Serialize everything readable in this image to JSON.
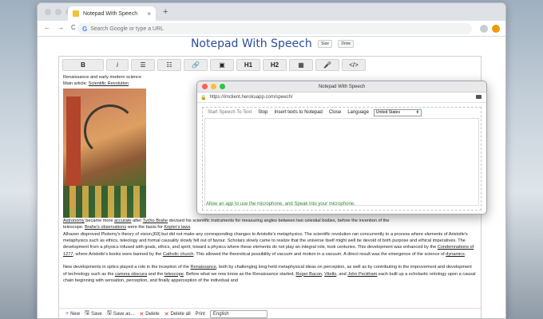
{
  "browser": {
    "tab_title": "Notepad With Speech",
    "new_tab": "+",
    "omnibox_placeholder": "Search Google or type a URL",
    "google_glyph": "G",
    "nav": [
      "←",
      "→",
      "C"
    ]
  },
  "app": {
    "title": "Notepad With Speech",
    "size_label": "Size",
    "drive_label": "Drive"
  },
  "toolbar": {
    "items": [
      "B",
      "i",
      "☰",
      "☷",
      "🔗",
      "▣",
      "H1",
      "H2",
      "▦",
      "🎤",
      "</>"
    ]
  },
  "content": {
    "heading1": "Renaissance and early modern science",
    "heading2_prefix": "Main article: ",
    "heading2_link": "Scientific Revolution",
    "line1_link1": "Astronomy",
    "line1_mid1": " became more ",
    "line1_link2": "accurate",
    "line1_mid2": " after ",
    "line1_link3": "Tycho Brahe",
    "line1_end": " devised his scientific instruments for measuring angles between two celestial bodies, before the invention of the",
    "line2_start": "telescope. ",
    "line2_link": "Brahe's observations",
    "line2_mid": " were the basis for ",
    "line2_link2": "Kepler's laws",
    "line2_end": ".",
    "para1": "Alhazen disproved Ptolemy's theory of vision,[69] but did not make any corresponding changes to Aristotle's metaphysics. The scientific revolution ran concurrently to a process where elements of Aristotle's metaphysics such as ethics, teleology and formal causality slowly fell out of favour. Scholars slowly came to realize that the universe itself might well be devoid of both purpose and ethical imperatives. The development from a physics infused with goals, ethics, and spirit, toward a physics where these elements do not play an integral role, took centuries. This development was enhanced by the ",
    "para1_link1": "Condemnations of 1277",
    "para1_mid": ", where Aristotle's books were banned by the ",
    "para1_link2": "Catholic church",
    "para1_end": ". This allowed the theoretical possibility of vacuum and motion in a vacuum. A direct result was the emergence of the science of ",
    "para1_link3": "dynamics",
    "para1_tail": ".",
    "para2_start": "New developments in optics played a role in the inception of the ",
    "para2_link1": "Renaissance",
    "para2_mid1": ", both by challenging long-held metaphysical ideas on perception, as well as by contributing to the improvement and development of technology such as the ",
    "para2_link2": "camera obscura",
    "para2_mid2": " and the ",
    "para2_link3": "telescope",
    "para2_mid3": ". Before what we now know as the Renaissance started, ",
    "para2_link4": "Roger Bacon",
    "para2_sep1": ", ",
    "para2_link5": "Vitello",
    "para2_mid4": ", and ",
    "para2_link6": "John Peckham",
    "para2_end": " each built up a scholastic ontology upon a causal chain beginning with sensation, perception, and finally apperception of the individual and"
  },
  "bottom": {
    "new": "New",
    "save": "Save",
    "save_as": "Save as...",
    "delete": "Delete",
    "delete_all": "Delete all",
    "print": "Print",
    "language": "English"
  },
  "popup": {
    "title": "Notepad With Speech",
    "url": "https://imclient.herokuapp.com/speech/",
    "start": "Start Speech To Text",
    "stop": "Stop",
    "insert": "Insert texts to Notepad",
    "close": "Close",
    "language_label": "Language",
    "language_value": "United States",
    "status": "Allow an app to use the microphone, and Speak into your microphone."
  },
  "colors": {
    "title": "#2c4d9a",
    "status": "#2c8a2c",
    "ext": "#f29900"
  }
}
